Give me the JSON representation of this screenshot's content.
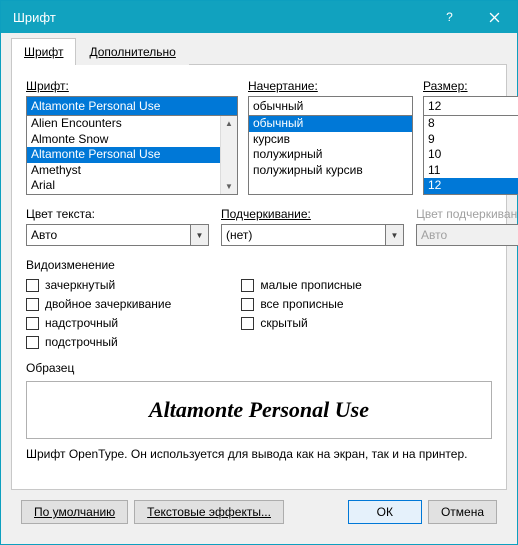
{
  "title": "Шрифт",
  "tabs": {
    "font": "Шрифт",
    "advanced": "Дополнительно"
  },
  "labels": {
    "font": "Шрифт:",
    "style": "Начертание:",
    "size": "Размер:",
    "textColor": "Цвет текста:",
    "underline": "Подчеркивание:",
    "underlineColor": "Цвет подчеркивания:",
    "effects": "Видоизменение",
    "preview": "Образец"
  },
  "font": {
    "value": "Altamonte Personal Use",
    "items": [
      "Alien Encounters",
      "Almonte Snow",
      "Altamonte Personal Use",
      "Amethyst",
      "Arial"
    ],
    "selectedIndex": 2
  },
  "style": {
    "value": "обычный",
    "items": [
      "обычный",
      "курсив",
      "полужирный",
      "полужирный курсив"
    ],
    "selectedIndex": 0
  },
  "size": {
    "value": "12",
    "items": [
      "8",
      "9",
      "10",
      "11",
      "12"
    ],
    "selectedIndex": 4
  },
  "textColor": {
    "value": "Авто"
  },
  "underline": {
    "value": "(нет)"
  },
  "underlineColor": {
    "value": "Авто"
  },
  "effects": {
    "left": [
      "зачеркнутый",
      "двойное зачеркивание",
      "надстрочный",
      "подстрочный"
    ],
    "right": [
      "малые прописные",
      "все прописные",
      "скрытый"
    ]
  },
  "previewText": "Altamonte Personal Use",
  "description": "Шрифт OpenType. Он используется для вывода как на экран, так и на принтер.",
  "buttons": {
    "default": "По умолчанию",
    "textEffects": "Текстовые эффекты...",
    "ok": "ОК",
    "cancel": "Отмена"
  }
}
